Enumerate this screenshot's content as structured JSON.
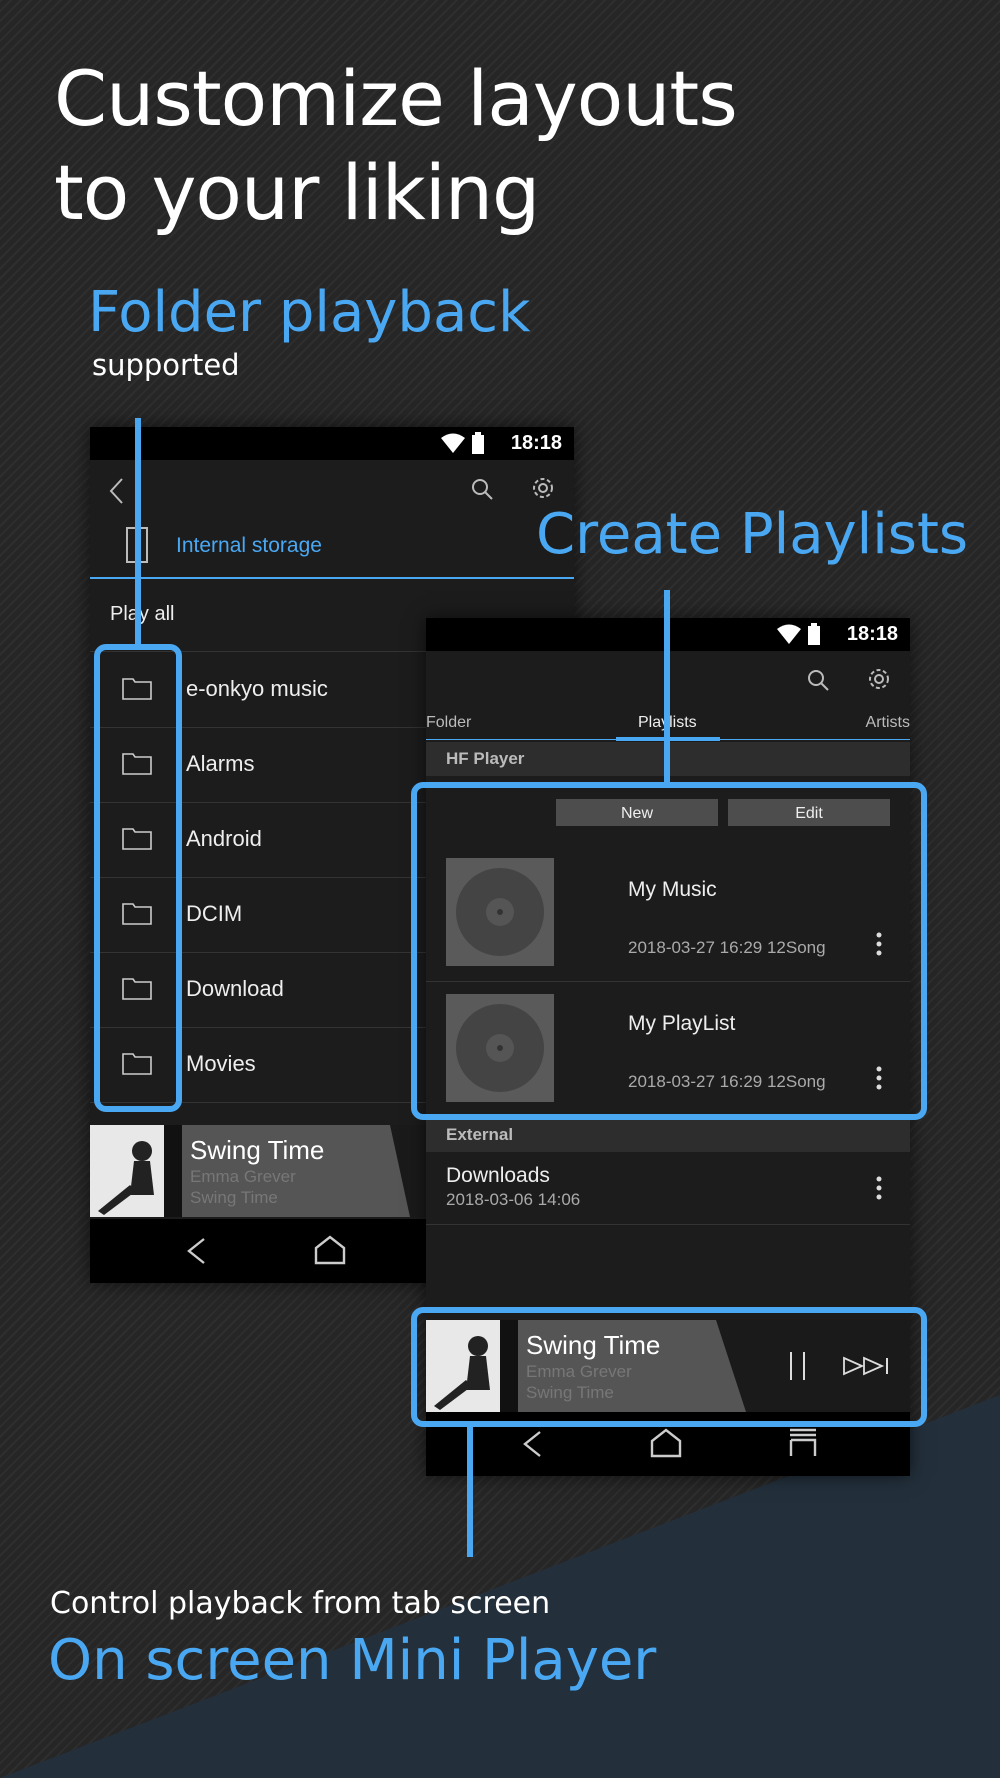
{
  "headline": {
    "line1": "Customize layouts",
    "line2": "to your liking"
  },
  "callouts": {
    "folder_title": "Folder playback",
    "folder_sub": "supported",
    "playlist_title": "Create Playlists",
    "mini_sub": "Control playback from tab screen",
    "mini_title": "On screen Mini Player"
  },
  "phone1": {
    "time": "18:18",
    "storage_label": "Internal storage",
    "play_all": "Play all",
    "folders": [
      "e-onkyo music",
      "Alarms",
      "Android",
      "DCIM",
      "Download",
      "Movies"
    ],
    "now_playing": {
      "title": "Swing Time",
      "artist": "Emma Grever",
      "album": "Swing Time"
    }
  },
  "phone2": {
    "time": "18:18",
    "tabs": [
      "Folder",
      "Playlists",
      "Artists"
    ],
    "section_hf": "HF Player",
    "new_label": "New",
    "edit_label": "Edit",
    "playlists": [
      {
        "name": "My Music",
        "meta": "2018-03-27 16:29  12Song"
      },
      {
        "name": "My PlayList",
        "meta": "2018-03-27 16:29  12Song"
      }
    ],
    "section_external": "External",
    "external": {
      "name": "Downloads",
      "date": "2018-03-06 14:06"
    },
    "now_playing": {
      "title": "Swing Time",
      "artist": "Emma Grever",
      "album": "Swing Time"
    }
  },
  "colors": {
    "accent": "#4aa8f3",
    "background": "#262626"
  }
}
